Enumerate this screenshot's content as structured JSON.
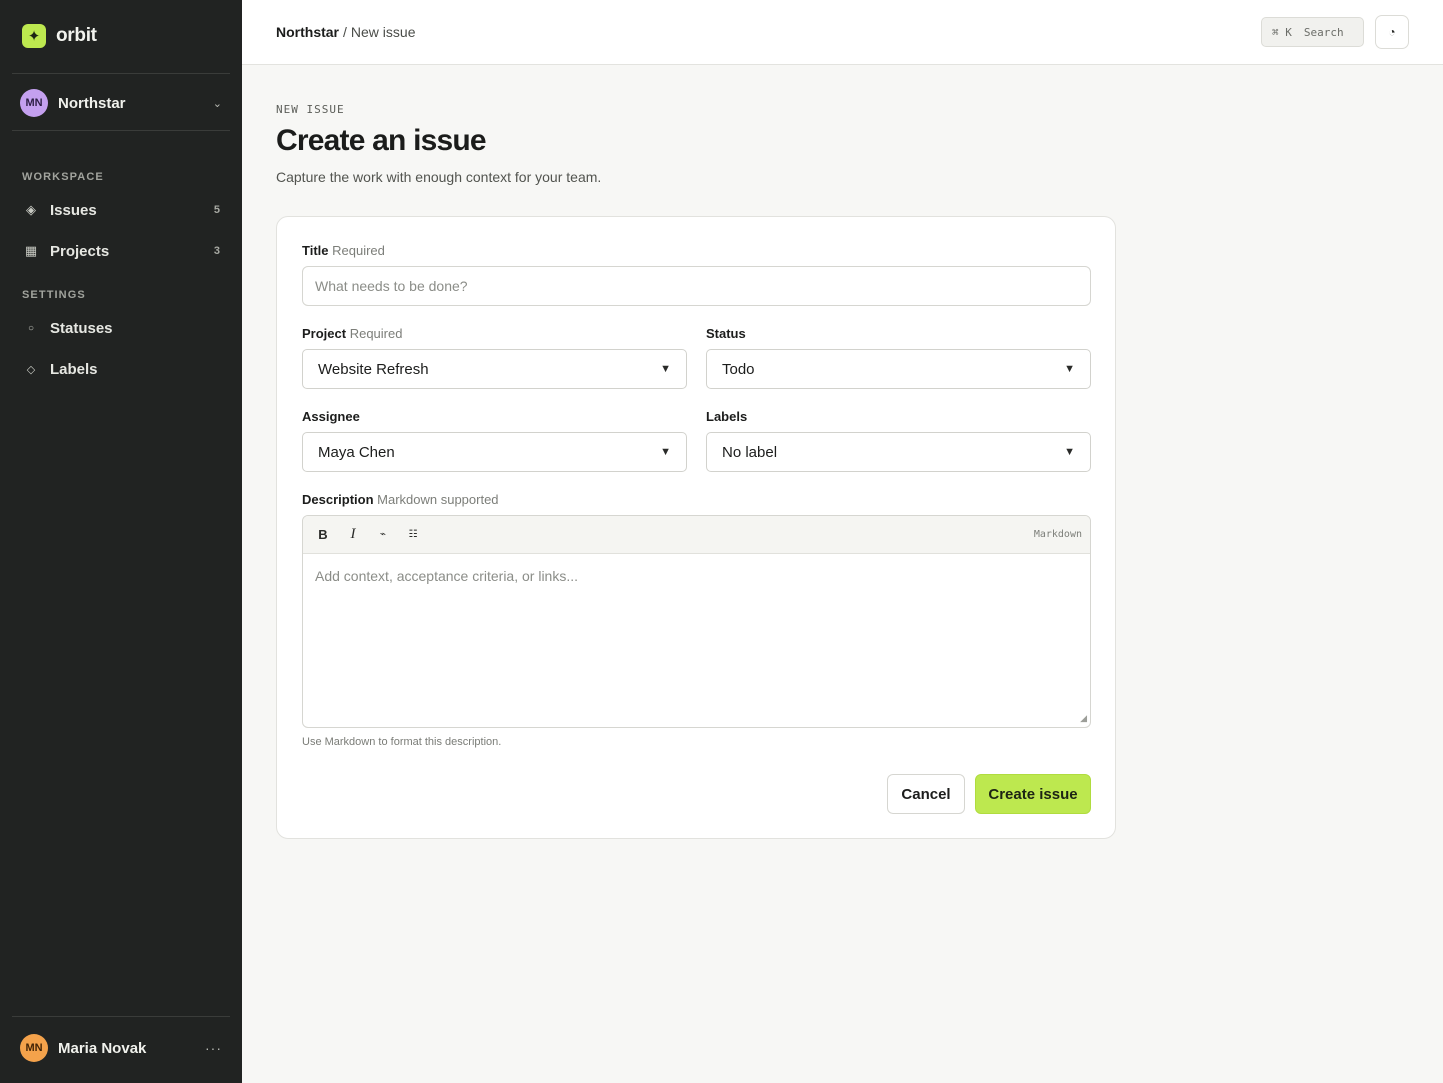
{
  "app": {
    "name": "orbit",
    "logo_glyph": "✦",
    "accent_color": "#bde84f"
  },
  "workspace": {
    "initials": "MN",
    "name": "Northstar"
  },
  "sidebar": {
    "sections": [
      {
        "label": "WORKSPACE",
        "items": [
          {
            "label": "Issues",
            "count": "5",
            "icon": "diamond-icon"
          },
          {
            "label": "Projects",
            "count": "3",
            "icon": "grid-icon"
          }
        ]
      },
      {
        "label": "SETTINGS",
        "items": [
          {
            "label": "Statuses",
            "icon": "circle-icon"
          },
          {
            "label": "Labels",
            "icon": "tag-diamond-icon"
          }
        ]
      }
    ]
  },
  "user": {
    "initials": "MN",
    "name": "Maria Novak"
  },
  "topbar": {
    "breadcrumb": {
      "workspace": "Northstar",
      "separator": "/",
      "current": "New issue"
    },
    "search": {
      "shortcut": "⌘ K",
      "label": "Search"
    }
  },
  "page": {
    "eyebrow": "NEW ISSUE",
    "title": "Create an issue",
    "subtitle": "Capture the work with enough context for your team."
  },
  "form": {
    "title_field": {
      "label": "Title",
      "hint": "Required",
      "placeholder": "What needs to be done?"
    },
    "project": {
      "label": "Project",
      "hint": "Required",
      "value": "Website Refresh"
    },
    "status": {
      "label": "Status",
      "value": "Todo"
    },
    "assignee": {
      "label": "Assignee",
      "value": "Maya Chen"
    },
    "labels": {
      "label": "Labels",
      "value": "No label"
    },
    "description": {
      "label": "Description",
      "hint": "Markdown supported",
      "toolbar": {
        "bold": "B",
        "italic": "I",
        "link": "⌁",
        "list": "☷",
        "mode": "Markdown"
      },
      "placeholder": "Add context, acceptance criteria, or links...",
      "help": "Use Markdown to format this description."
    },
    "cancel_label": "Cancel",
    "submit_label": "Create issue"
  }
}
